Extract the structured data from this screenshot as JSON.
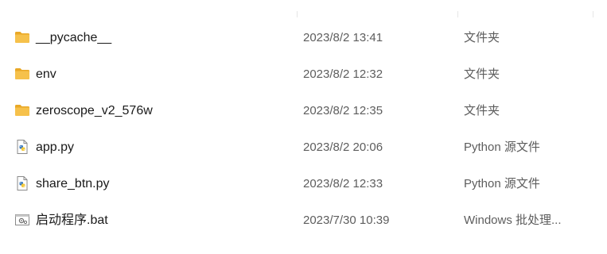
{
  "colors": {
    "folder": "#F6C14B",
    "folder_dark": "#E9A826",
    "python_blue": "#3B7BBF",
    "python_yellow": "#F3C83A",
    "text_primary": "#1a1a1a",
    "text_secondary": "#5d5d5d"
  },
  "files": [
    {
      "name": "__pycache__",
      "modified": "2023/8/2 13:41",
      "type": "文件夹",
      "icon": "folder-icon"
    },
    {
      "name": "env",
      "modified": "2023/8/2 12:32",
      "type": "文件夹",
      "icon": "folder-icon"
    },
    {
      "name": "zeroscope_v2_576w",
      "modified": "2023/8/2 12:35",
      "type": "文件夹",
      "icon": "folder-icon"
    },
    {
      "name": "app.py",
      "modified": "2023/8/2 20:06",
      "type": "Python 源文件",
      "icon": "python-file-icon"
    },
    {
      "name": "share_btn.py",
      "modified": "2023/8/2 12:33",
      "type": "Python 源文件",
      "icon": "python-file-icon"
    },
    {
      "name": "启动程序.bat",
      "modified": "2023/7/30 10:39",
      "type": "Windows 批处理...",
      "icon": "batch-file-icon"
    }
  ]
}
